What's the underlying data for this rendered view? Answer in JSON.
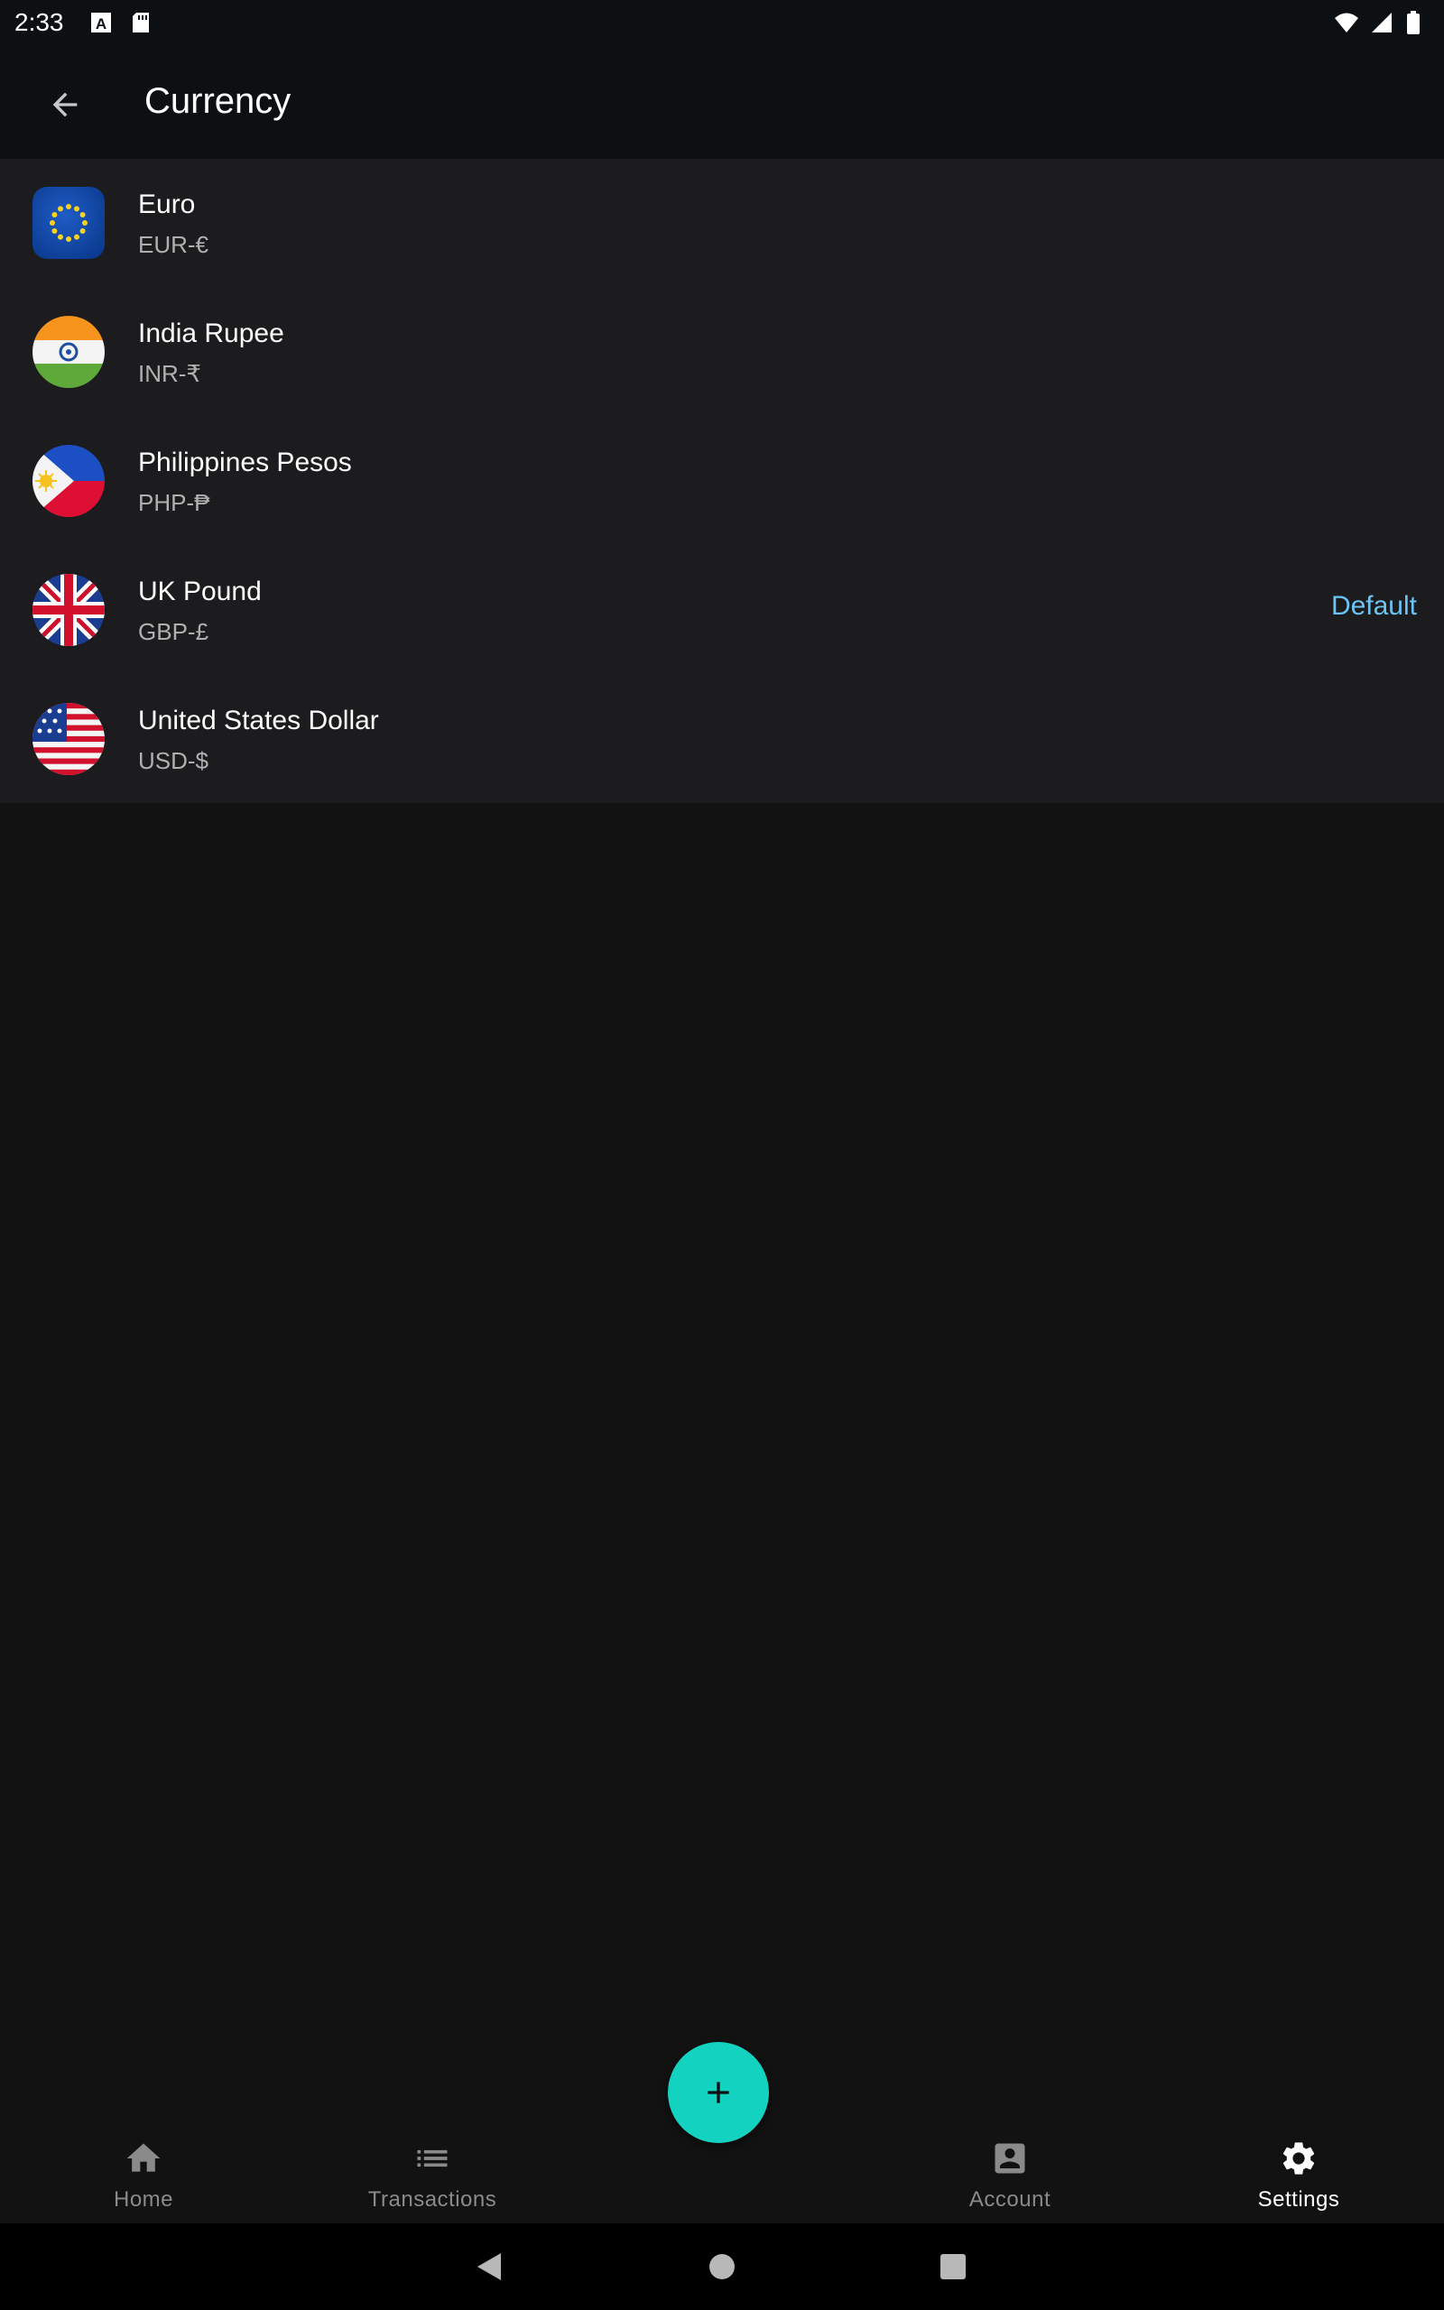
{
  "status_bar": {
    "time": "2:33",
    "icons_left": [
      "font-a-icon",
      "sd-card-icon"
    ],
    "icons_right": [
      "wifi-icon",
      "signal-icon",
      "battery-icon"
    ]
  },
  "app_bar": {
    "title": "Currency",
    "back_icon": "arrow-back-icon"
  },
  "currencies": [
    {
      "name": "Euro",
      "code": "EUR-€",
      "flag": "eu",
      "default": ""
    },
    {
      "name": "India Rupee",
      "code": "INR-₹",
      "flag": "in",
      "default": ""
    },
    {
      "name": "Philippines Pesos",
      "code": "PHP-₱",
      "flag": "ph",
      "default": ""
    },
    {
      "name": "UK Pound",
      "code": "GBP-£",
      "flag": "gb",
      "default": "Default"
    },
    {
      "name": "United States Dollar",
      "code": "USD-$",
      "flag": "us",
      "default": ""
    }
  ],
  "fab": {
    "icon": "plus-icon"
  },
  "bottom_nav": {
    "items": [
      {
        "label": "Home",
        "icon": "home-icon"
      },
      {
        "label": "Transactions",
        "icon": "list-icon"
      },
      {
        "label": "Account",
        "icon": "account-box-icon"
      },
      {
        "label": "Settings",
        "icon": "gear-icon",
        "active": true
      }
    ]
  },
  "colors": {
    "accent": "#13d3c0",
    "default_link": "#6cc4f5",
    "background": "#121212",
    "list_background": "#1c1c1e"
  }
}
